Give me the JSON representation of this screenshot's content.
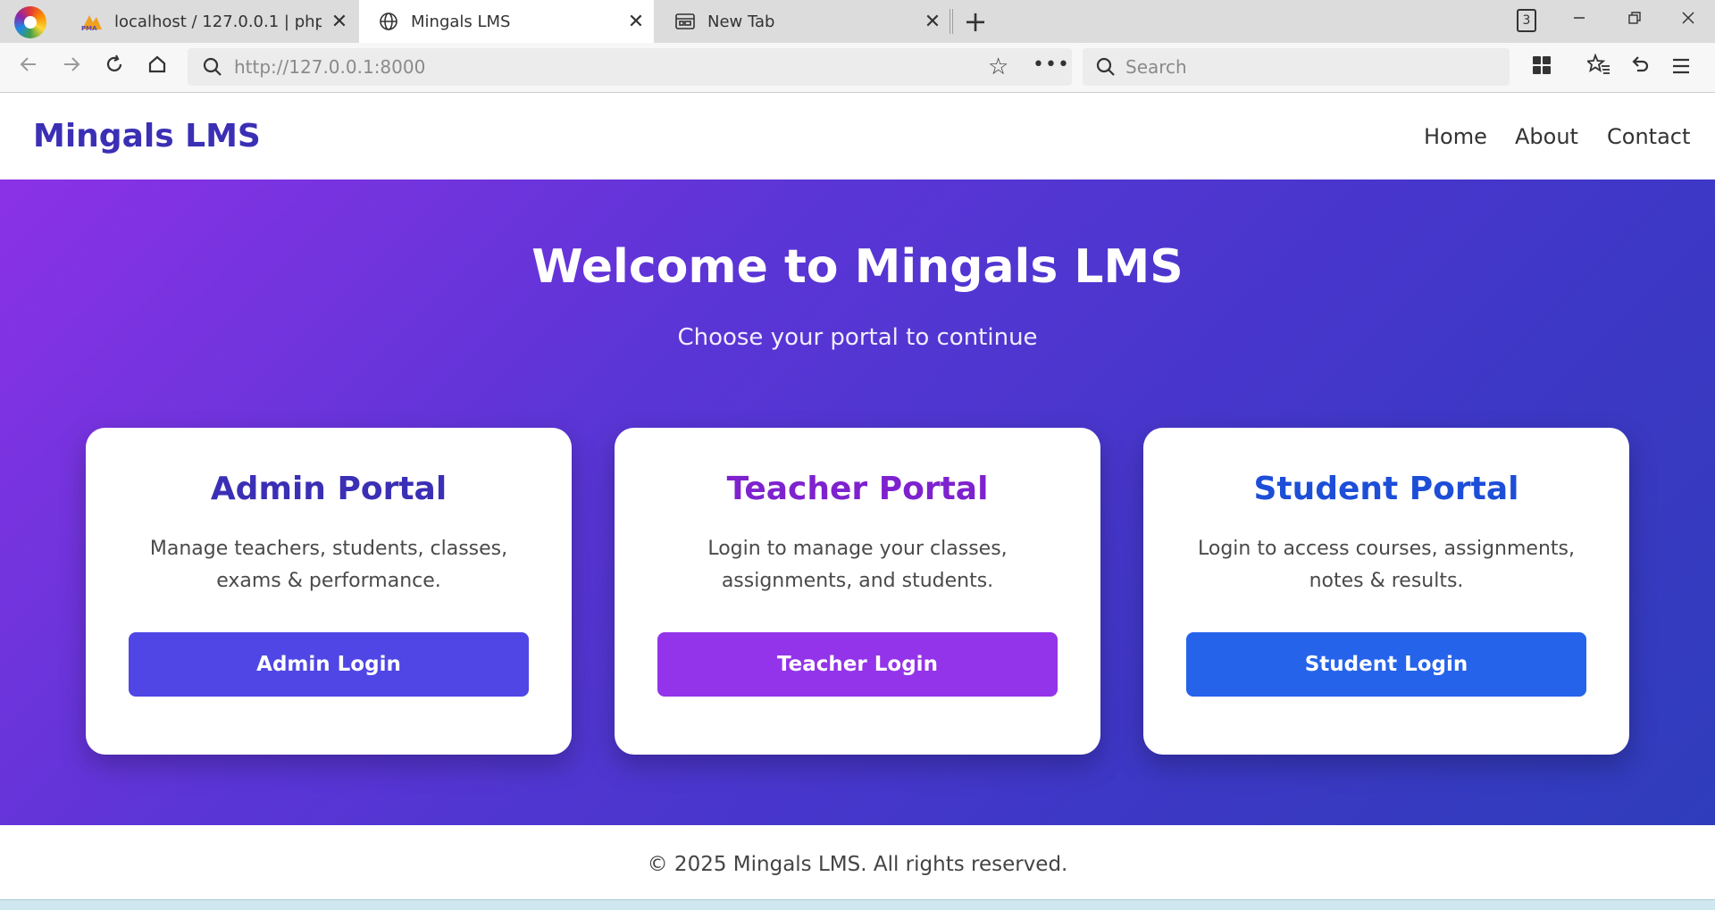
{
  "browser": {
    "tabs": [
      {
        "label": "localhost / 127.0.0.1 | phpMyA",
        "favicon": "pma-icon"
      },
      {
        "label": "Mingals LMS",
        "favicon": "globe-icon"
      },
      {
        "label": "New Tab",
        "favicon": "newtab-icon"
      }
    ],
    "close_glyph": "✕",
    "new_tab_glyph": "+",
    "tab_count": "3",
    "url": "http://127.0.0.1:8000",
    "search_placeholder": "Search"
  },
  "site": {
    "brand": "Mingals LMS",
    "nav": [
      "Home",
      "About",
      "Contact"
    ]
  },
  "hero": {
    "title": "Welcome to Mingals LMS",
    "subtitle": "Choose your portal to continue"
  },
  "portals": [
    {
      "title": "Admin Portal",
      "description": "Manage teachers, students, classes, exams & performance.",
      "button": "Admin Login",
      "title_color": "#3b2fb5",
      "button_color": "#4f46e5"
    },
    {
      "title": "Teacher Portal",
      "description": "Login to manage your classes, assignments, and students.",
      "button": "Teacher Login",
      "title_color": "#7e22ce",
      "button_color": "#9333ea"
    },
    {
      "title": "Student Portal",
      "description": "Login to access courses, assignments, notes & results.",
      "button": "Student Login",
      "title_color": "#1d4ed8",
      "button_color": "#2563eb"
    }
  ],
  "footer": {
    "text": "© 2025 Mingals LMS. All rights reserved."
  },
  "colors": {
    "hero_start": "#8b32e6",
    "hero_end": "#2f3dbb",
    "brand": "#3b2fb5"
  }
}
